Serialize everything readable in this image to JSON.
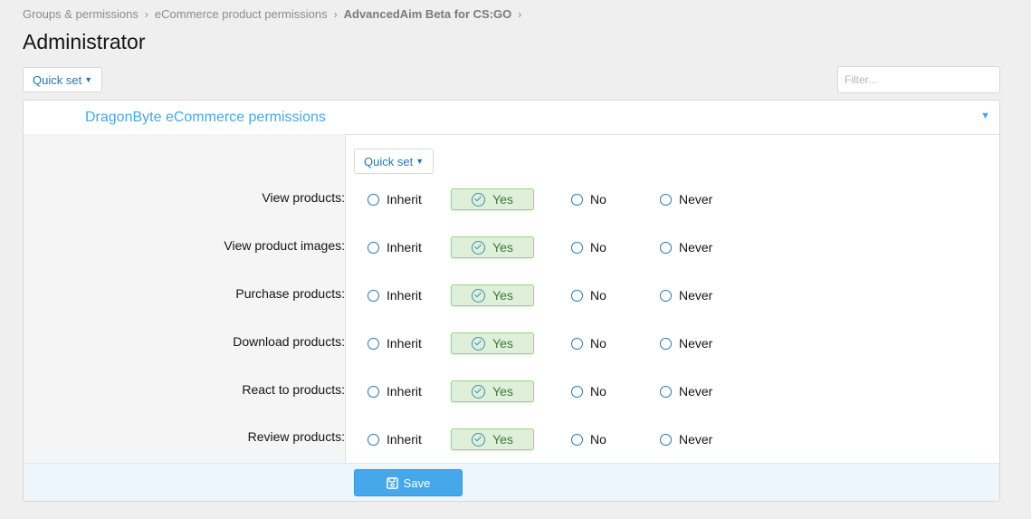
{
  "breadcrumb": {
    "items": [
      "Groups & permissions",
      "eCommerce product permissions",
      "AdvancedAim Beta for CS:GO"
    ],
    "separator": "›"
  },
  "page": {
    "title": "Administrator"
  },
  "toolbar": {
    "quick_set_label": "Quick set",
    "filter_placeholder": "Filter..."
  },
  "panel": {
    "title": "DragonByte eCommerce permissions",
    "quick_set_label": "Quick set",
    "options": {
      "inherit": "Inherit",
      "yes": "Yes",
      "no": "No",
      "never": "Never"
    },
    "rows": [
      {
        "label": "View products:",
        "selected": "yes"
      },
      {
        "label": "View product images:",
        "selected": "yes"
      },
      {
        "label": "Purchase products:",
        "selected": "yes"
      },
      {
        "label": "Download products:",
        "selected": "yes"
      },
      {
        "label": "React to products:",
        "selected": "yes"
      },
      {
        "label": "Review products:",
        "selected": "yes"
      }
    ],
    "save_label": "Save"
  },
  "colors": {
    "accent": "#47a7eb",
    "link": "#2577b1",
    "yes_bg": "#dff0d8",
    "yes_text": "#3c763d"
  },
  "icons": {
    "caret": "caret-down-icon",
    "save": "save-icon",
    "check": "check-circle-icon",
    "collapse": "collapse-icon"
  }
}
